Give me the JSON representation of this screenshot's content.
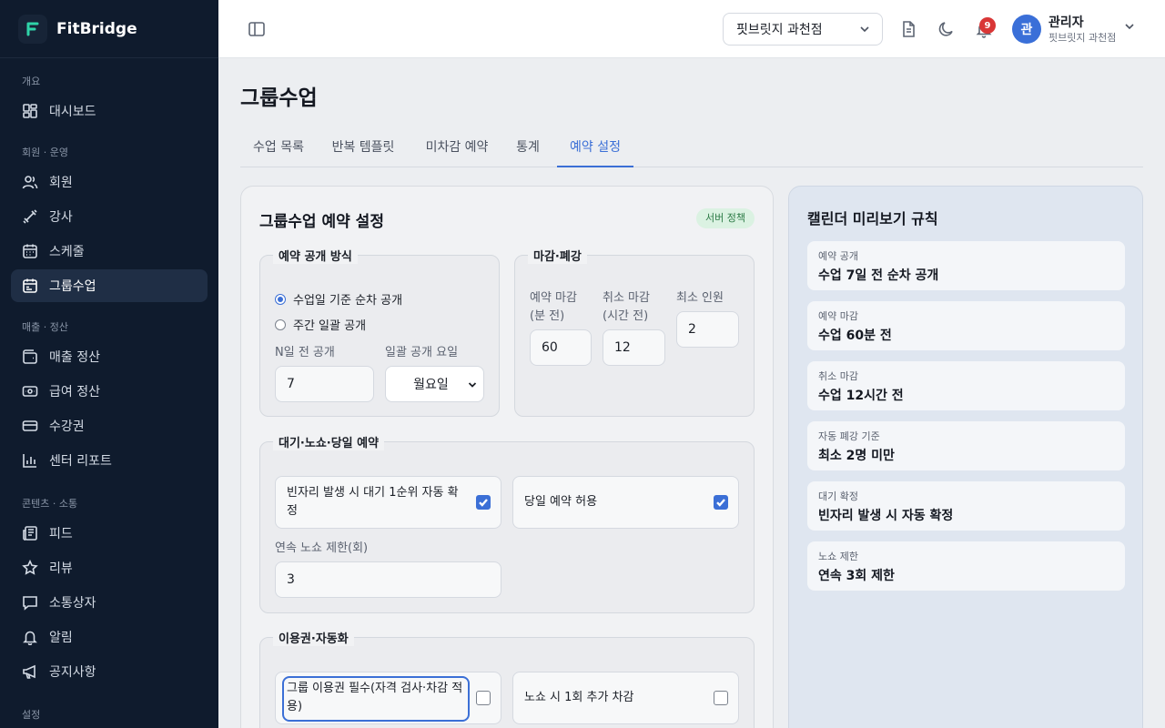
{
  "app": {
    "name": "FitBridge"
  },
  "sidebar": {
    "sections": [
      {
        "title": "개요",
        "items": [
          {
            "label": "대시보드",
            "icon": "dashboard-icon"
          }
        ]
      },
      {
        "title": "회원 · 운영",
        "items": [
          {
            "label": "회원",
            "icon": "users-icon"
          },
          {
            "label": "강사",
            "icon": "dumbbell-icon"
          },
          {
            "label": "스케줄",
            "icon": "calendar-icon"
          },
          {
            "label": "그룹수업",
            "icon": "calendar-check-icon",
            "active": true
          }
        ]
      },
      {
        "title": "매출 · 정산",
        "items": [
          {
            "label": "매출 정산",
            "icon": "wallet-icon"
          },
          {
            "label": "급여 정산",
            "icon": "banknote-icon"
          },
          {
            "label": "수강권",
            "icon": "credit-card-icon"
          },
          {
            "label": "센터 리포트",
            "icon": "bar-chart-icon"
          }
        ]
      },
      {
        "title": "콘텐츠 · 소통",
        "items": [
          {
            "label": "피드",
            "icon": "newspaper-icon"
          },
          {
            "label": "리뷰",
            "icon": "star-icon"
          },
          {
            "label": "소통상자",
            "icon": "message-icon"
          },
          {
            "label": "알림",
            "icon": "bell-icon"
          },
          {
            "label": "공지사항",
            "icon": "megaphone-icon"
          }
        ]
      },
      {
        "title": "설정",
        "items": []
      }
    ]
  },
  "topbar": {
    "branch": "핏브릿지 과천점",
    "notification_count": "9",
    "user": {
      "avatar": "관",
      "name": "관리자",
      "branch": "핏브릿지 과천점"
    }
  },
  "page": {
    "title": "그룹수업",
    "tabs": [
      {
        "label": "수업 목록"
      },
      {
        "label": "반복 템플릿"
      },
      {
        "label": "미차감 예약"
      },
      {
        "label": "통계"
      },
      {
        "label": "예약 설정",
        "active": true
      }
    ]
  },
  "settings": {
    "title": "그룹수업 예약 설정",
    "badge": "서버 정책",
    "open_method": {
      "legend": "예약 공개 방식",
      "options": [
        {
          "label": "수업일 기준 순차 공개",
          "selected": true
        },
        {
          "label": "주간 일괄 공개",
          "selected": false
        }
      ],
      "days_before_label": "N일 전 공개",
      "days_before_value": "7",
      "weekday_label": "일괄 공개 요일",
      "weekday_value": "월요일"
    },
    "deadline": {
      "legend": "마감·폐강",
      "booking_deadline_label_1": "예약 마감",
      "booking_deadline_label_2": "(분 전)",
      "booking_deadline_value": "60",
      "cancel_deadline_label_1": "취소 마감",
      "cancel_deadline_label_2": "(시간 전)",
      "cancel_deadline_value": "12",
      "min_people_label": "최소 인원",
      "min_people_value": "2"
    },
    "waitlist": {
      "legend": "대기·노쇼·당일 예약",
      "auto_confirm_label_1": "빈자리 발생 시 대기 1순위 자동 확",
      "auto_confirm_label_2": "정",
      "auto_confirm_checked": true,
      "same_day_label": "당일 예약 허용",
      "same_day_checked": true,
      "noshow_limit_label": "연속 노쇼 제한(회)",
      "noshow_limit_value": "3"
    },
    "pass": {
      "legend": "이용권·자동화",
      "require_pass_label_1": "그룹 이용권 필수(자격 검사·차감 적",
      "require_pass_label_2": "용)",
      "require_pass_checked": false,
      "noshow_deduct_label": "노쇼 시 1회 추가 차감",
      "noshow_deduct_checked": false
    }
  },
  "preview": {
    "title": "캘린더 미리보기 규칙",
    "rules": [
      {
        "key": "예약 공개",
        "value": "수업 7일 전 순차 공개"
      },
      {
        "key": "예약 마감",
        "value": "수업 60분 전"
      },
      {
        "key": "취소 마감",
        "value": "수업 12시간 전"
      },
      {
        "key": "자동 폐강 기준",
        "value": "최소 2명 미만"
      },
      {
        "key": "대기 확정",
        "value": "빈자리 발생 시 자동 확정"
      },
      {
        "key": "노쇼 제한",
        "value": "연속 3회 제한"
      }
    ]
  }
}
